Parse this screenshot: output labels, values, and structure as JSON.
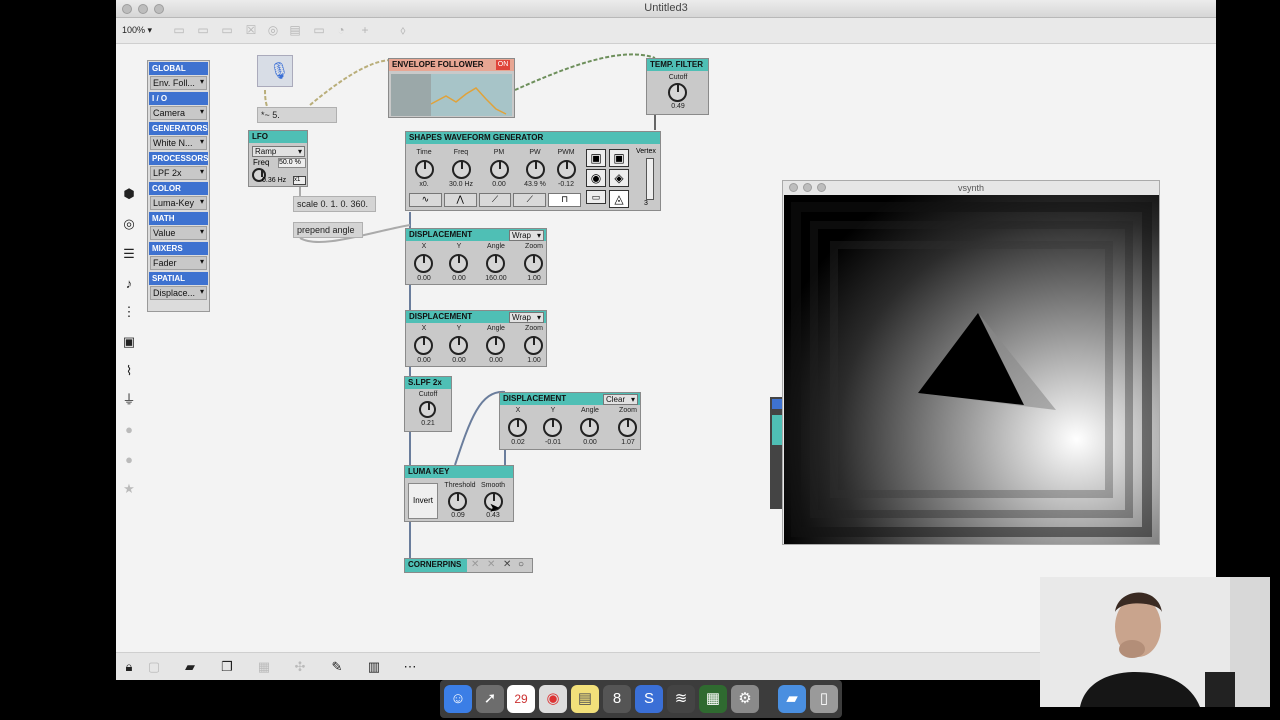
{
  "window": {
    "title": "Untitled3",
    "zoom": "100% ▾"
  },
  "browser": {
    "sections": [
      {
        "header": "GLOBAL",
        "value": "Env. Foll..."
      },
      {
        "header": "I / O",
        "value": "Camera"
      },
      {
        "header": "GENERATORS",
        "value": "White N..."
      },
      {
        "header": "PROCESSORS",
        "value": "LPF 2x"
      },
      {
        "header": "COLOR",
        "value": "Luma-Key"
      },
      {
        "header": "MATH",
        "value": "Value"
      },
      {
        "header": "MIXERS",
        "value": "Fader"
      },
      {
        "header": "SPATIAL",
        "value": "Displace..."
      }
    ]
  },
  "lfo": {
    "title": "LFO",
    "shape": "Ramp",
    "freq_label": "Freq",
    "freq_pct": "50.0 %",
    "freq_hz": "0.36 Hz",
    "mult": "x1"
  },
  "messages": {
    "num": "*~ 5.",
    "scale": "scale 0. 1. 0. 360.",
    "prepend": "prepend angle"
  },
  "envelope": {
    "title": "ENVELOPE FOLLOWER",
    "on": "ON"
  },
  "temp_filter": {
    "title": "TEMP. FILTER",
    "label": "Cutoff",
    "value": "0.49"
  },
  "shapes": {
    "title": "SHAPES WAVEFORM GENERATOR",
    "knobs": [
      {
        "label": "Time",
        "value": "x0."
      },
      {
        "label": "Freq",
        "value": "30.0 Hz"
      },
      {
        "label": "PM",
        "value": "0.00"
      },
      {
        "label": "PW",
        "value": "43.9 %"
      },
      {
        "label": "PWM",
        "value": "-0.12"
      }
    ],
    "vertex_label": "Vertex",
    "vertex_value": "3"
  },
  "disp1": {
    "title": "DISPLACEMENT",
    "mode": "Wrap",
    "knobs": [
      {
        "label": "X",
        "value": "0.00"
      },
      {
        "label": "Y",
        "value": "0.00"
      },
      {
        "label": "Angle",
        "value": "160.00"
      },
      {
        "label": "Zoom",
        "value": "1.00"
      }
    ]
  },
  "disp2": {
    "title": "DISPLACEMENT",
    "mode": "Wrap",
    "knobs": [
      {
        "label": "X",
        "value": "0.00"
      },
      {
        "label": "Y",
        "value": "0.00"
      },
      {
        "label": "Angle",
        "value": "0.00"
      },
      {
        "label": "Zoom",
        "value": "1.00"
      }
    ]
  },
  "disp3": {
    "title": "DISPLACEMENT",
    "mode": "Clear",
    "knobs": [
      {
        "label": "X",
        "value": "0.02"
      },
      {
        "label": "Y",
        "value": "-0.01"
      },
      {
        "label": "Angle",
        "value": "0.00"
      },
      {
        "label": "Zoom",
        "value": "1.07"
      }
    ]
  },
  "slpf": {
    "title": "S.LPF  2x",
    "label": "Cutoff",
    "value": "0.21"
  },
  "lumakey": {
    "title": "LUMA KEY",
    "invert": "Invert",
    "threshold_label": "Threshold",
    "threshold": "0.09",
    "smooth_label": "Smooth",
    "smooth": "0.43"
  },
  "cornerpins": {
    "title": "CORNERPINS"
  },
  "vsynth": {
    "title": "vsynth"
  },
  "dock": {
    "calendar_day": "29"
  },
  "colors": {
    "module_header": "#4fbfb5",
    "browser_header": "#3e72d0",
    "on_button": "#e0443a"
  }
}
